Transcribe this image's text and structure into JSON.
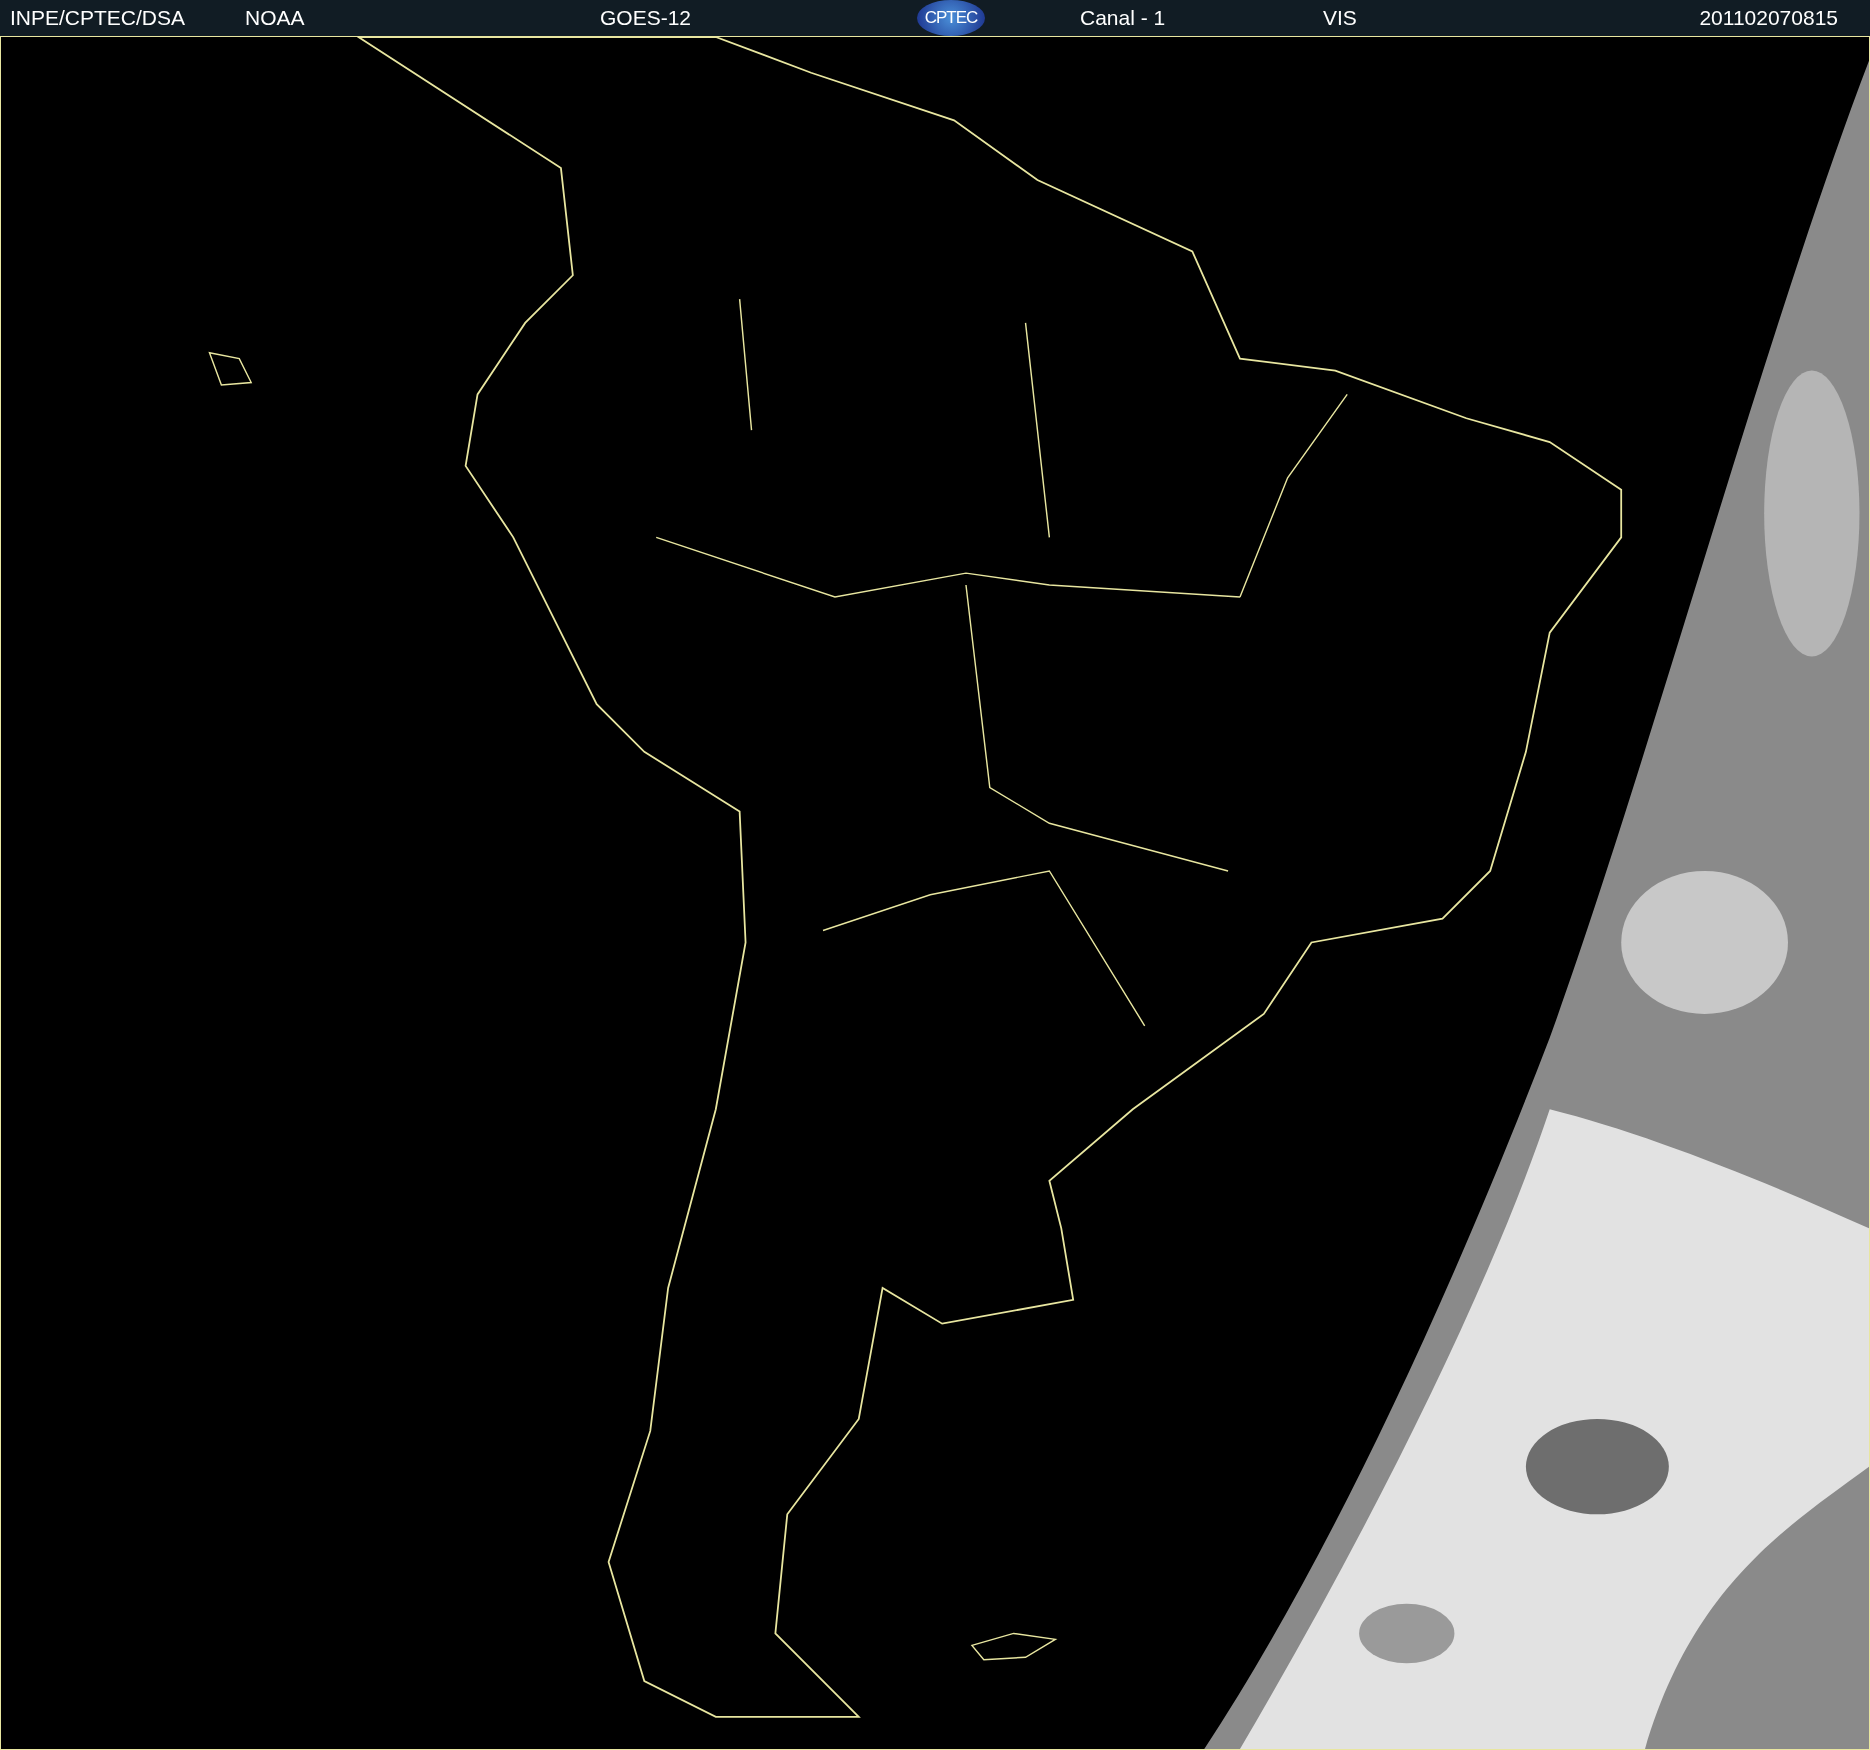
{
  "header": {
    "source": "INPE/CPTEC/DSA",
    "agency": "NOAA",
    "satellite": "GOES-12",
    "logo": "CPTEC",
    "channel": "Canal - 1",
    "band": "VIS",
    "timestamp": "201102070815"
  }
}
